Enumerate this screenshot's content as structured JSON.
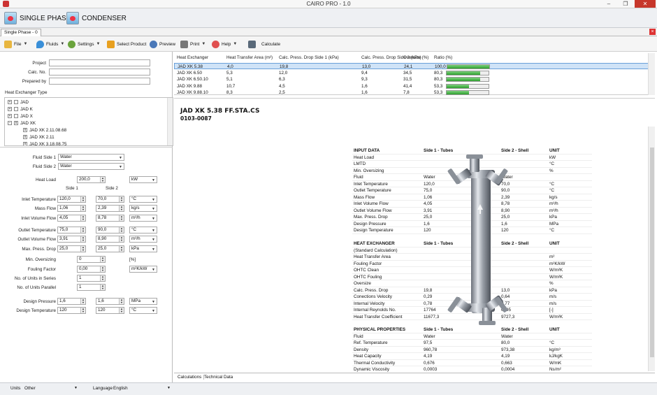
{
  "window": {
    "title": "CAIRO PRO - 1.0"
  },
  "ribbon": {
    "single_phase": "SINGLE PHASE",
    "condenser": "CONDENSER"
  },
  "tab": {
    "label": "Single Phase - 0"
  },
  "toolbar": {
    "file": "File",
    "fluids": "Fluids",
    "settings": "Settings",
    "select_product": "Select Product",
    "preview": "Preview",
    "print": "Print",
    "help": "Help",
    "calculate": "Calculate"
  },
  "form": {
    "project": "Project",
    "calc_no": "Calc. No.",
    "prepared_by": "Prepared by",
    "hx_type": "Heat Exchanger Type"
  },
  "tree": [
    {
      "label": "JAD",
      "checked": ""
    },
    {
      "label": "JAD K",
      "checked": ""
    },
    {
      "label": "JAD X",
      "checked": ""
    },
    {
      "label": "JAD XK",
      "checked": "x"
    },
    {
      "label": "JAD XK 2.11.08.68",
      "checked": "x"
    },
    {
      "label": "JAD XK 2.11",
      "checked": "x"
    },
    {
      "label": "JAD XK 3.18.08.75",
      "checked": "x"
    }
  ],
  "inputs": {
    "fluid_side1_label": "Fluid Side 1",
    "fluid_side1": "Water",
    "fluid_side2_label": "Fluid Side 2",
    "fluid_side2": "Water",
    "heat_load_label": "Heat Load",
    "heat_load": "200,0",
    "heat_load_unit": "kW",
    "side1": "Side 1",
    "side2": "Side 2",
    "rows": [
      {
        "label": "Inlet Temperature",
        "v1": "120,0",
        "v2": "70,0",
        "unit": "°C"
      },
      {
        "label": "Mass Flow",
        "v1": "1,06",
        "v2": "2,39",
        "unit": "kg/s"
      },
      {
        "label": "Inlet Volume Flow",
        "v1": "4,05",
        "v2": "8,78",
        "unit": "m³/h"
      },
      {
        "label": "Outlet Temperature",
        "v1": "75,0",
        "v2": "90,0",
        "unit": "°C"
      },
      {
        "label": "Outlet Volume Flow",
        "v1": "3,91",
        "v2": "8,90",
        "unit": "m³/h"
      },
      {
        "label": "Max. Press. Drop",
        "v1": "25,0",
        "v2": "25,0",
        "unit": "kPa"
      }
    ],
    "min_oversizing_label": "Min. Oversizing",
    "min_oversizing": "0",
    "min_oversizing_unit": "[%]",
    "fouling_label": "Fouling Factor",
    "fouling": "0,00",
    "fouling_unit": "m²K/kW",
    "units_series_label": "No. of Units in Series",
    "units_series": "1",
    "units_parallel_label": "No. of Units Parallel",
    "units_parallel": "1",
    "design_pressure_label": "Design Pressure",
    "dp1": "1,6",
    "dp2": "1,6",
    "dp_unit": "MPa",
    "design_temp_label": "Design Temperature",
    "dt1": "120",
    "dt2": "120",
    "dt_unit": "°C"
  },
  "results": {
    "headers": [
      "Heat Exchanger",
      "Heat Transfer Area (m²)",
      "Calc. Press. Drop Side 1 (kPa)",
      "Calc. Press. Drop Side 2 (kPa)",
      "Oversize (%)",
      "Ratio (%)"
    ],
    "rows": [
      {
        "name": "JAD XK 5.38",
        "area": "4,0",
        "dp1": "19,8",
        "dp2": "13,0",
        "over": "24,1",
        "ratio": "100,0",
        "pct": 100
      },
      {
        "name": "JAD XK 6.50",
        "area": "5,3",
        "dp1": "12,0",
        "dp2": "9,4",
        "over": "34,5",
        "ratio": "80,3",
        "pct": 80.3
      },
      {
        "name": "JAD XK 6.50.10",
        "area": "5,1",
        "dp1": "6,3",
        "dp2": "9,3",
        "over": "31,5",
        "ratio": "80,3",
        "pct": 80.3
      },
      {
        "name": "JAD XK 9.88",
        "area": "10,7",
        "dp1": "4,5",
        "dp2": "1,6",
        "over": "41,4",
        "ratio": "53,3",
        "pct": 53.3
      },
      {
        "name": "JAD XK 9.88.10",
        "area": "8,3",
        "dp1": "2,5",
        "dp2": "1,6",
        "over": "7,8",
        "ratio": "53,3",
        "pct": 53.3
      }
    ]
  },
  "report": {
    "title": "JAD XK 5.38 FF.STA.CS",
    "code": "0103-0087",
    "input": {
      "h": [
        "INPUT DATA",
        "Side 1 - Tubes",
        "Side 2 - Shell",
        "UNIT"
      ],
      "rows": [
        [
          "Heat Load",
          "",
          "200,0",
          "",
          "kW"
        ],
        [
          "LMTD",
          "",
          "14,0",
          "",
          "°C"
        ],
        [
          "Min. Oversizing",
          "",
          "0",
          "",
          "%"
        ],
        [
          "Fluid",
          "Water",
          "",
          "Water",
          ""
        ],
        [
          "Inlet Temperature",
          "120,0",
          "",
          "70,0",
          "°C"
        ],
        [
          "Outlet Temperature",
          "75,0",
          "",
          "90,0",
          "°C"
        ],
        [
          "Mass Flow",
          "1,06",
          "",
          "2,39",
          "kg/s"
        ],
        [
          "Inlet Volume Flow",
          "4,05",
          "",
          "8,78",
          "m³/h"
        ],
        [
          "Outlet Volume Flow",
          "3,91",
          "",
          "8,90",
          "m³/h"
        ],
        [
          "Max. Press. Drop",
          "25,0",
          "",
          "25,0",
          "kPa"
        ],
        [
          "Design Pressure",
          "1,6",
          "",
          "1,6",
          "MPa"
        ],
        [
          "Design Temperature",
          "120",
          "",
          "120",
          "°C"
        ]
      ]
    },
    "hx": {
      "h": [
        "HEAT EXCHANGER",
        "Side 1 - Tubes",
        "Side 2 - Shell",
        "UNIT"
      ],
      "rows": [
        [
          "(Standard Calculation)",
          "",
          "",
          "",
          ""
        ],
        [
          "Heat Transfer Area",
          "",
          "4,0",
          "",
          "m²"
        ],
        [
          "Fouling Factor",
          "",
          "0,05",
          "",
          "m²K/kW"
        ],
        [
          "OHTC Clean",
          "",
          "4425,1",
          "",
          "W/m²K"
        ],
        [
          "OHTC Fouling",
          "",
          "3565,7",
          "",
          "W/m²K"
        ],
        [
          "Oversize",
          "",
          "24",
          "",
          "%"
        ],
        [
          "Calc. Press. Drop",
          "19,8",
          "",
          "13,0",
          "kPa"
        ],
        [
          "Conections Velocity",
          "0,29",
          "",
          "0,64",
          "m/s"
        ],
        [
          "Internal Velocity",
          "0,78",
          "",
          "0,77",
          "m/s"
        ],
        [
          "Internal Reynolds No.",
          "17764",
          "",
          "6305",
          "[-]"
        ],
        [
          "Heat Transfer Coefficient",
          "11677,3",
          "",
          "9727,3",
          "W/m²K"
        ]
      ]
    },
    "phys": {
      "h": [
        "PHYSICAL PROPERTIES",
        "Side 1 - Tubes",
        "Side 2 - Shell",
        "UNIT"
      ],
      "rows": [
        [
          "Fluid",
          "Water",
          "",
          "Water",
          ""
        ],
        [
          "Ref. Temperature",
          "97,5",
          "",
          "80,0",
          "°C"
        ],
        [
          "Density",
          "960,78",
          "",
          "973,38",
          "kg/m³"
        ],
        [
          "Heat Capacity",
          "4,19",
          "",
          "4,19",
          "kJ/kgK"
        ],
        [
          "Thermal Conductivity",
          "0,676",
          "",
          "0,663",
          "W/mK"
        ],
        [
          "Dynamic Viscosity",
          "0,0003",
          "",
          "0,0004",
          "Ns/m²"
        ]
      ]
    }
  },
  "bottom_tabs": {
    "calculations": "Calculations",
    "technical": "Technical Data"
  },
  "status": {
    "units_label": "Units",
    "units": "Other",
    "lang_label": "Language",
    "lang": "English"
  }
}
